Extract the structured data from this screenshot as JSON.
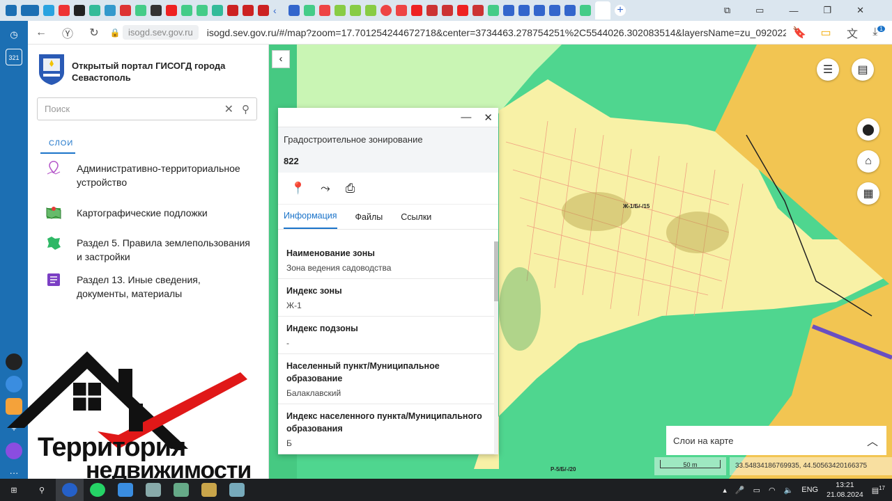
{
  "browser": {
    "site_chip": "isogd.sev.gov.ru",
    "url": "isogd.sev.gov.ru/#/map?zoom=17.701254244672718&center=3734463.278754251%2C5544026.302083514&layersName=zu_092022_...",
    "sidebar_badge": "321",
    "download_badge": "1"
  },
  "left_panel": {
    "portal_title": "Открытый портал ГИСОГД города Севастополь",
    "search_placeholder": "Поиск",
    "layers_tab": "СЛОИ",
    "layers": [
      {
        "label": "Административно-территориальное устройство",
        "icon": "map-pin-purple-icon"
      },
      {
        "label": "Картографические подложки",
        "icon": "map-basemap-icon"
      },
      {
        "label": "Раздел 5. Правила землепользования и застройки",
        "icon": "region-map-icon"
      },
      {
        "label": "Раздел 13. Иные сведения, документы, материалы",
        "icon": "document-list-icon"
      }
    ]
  },
  "popup": {
    "title": "Градостроительное зонирование",
    "number": "822",
    "tabs": [
      "Информация",
      "Файлы",
      "Ссылки"
    ],
    "fields": [
      {
        "label": "Наименование зоны",
        "value": "Зона ведения садоводства"
      },
      {
        "label": "Индекс зоны",
        "value": "Ж-1"
      },
      {
        "label": "Индекс подзоны",
        "value": "-"
      },
      {
        "label": "Населенный пункт/Муниципальное образование",
        "value": "Балаклавский"
      },
      {
        "label": "Индекс населенного пункта/Муниципального образования",
        "value": "Б"
      }
    ]
  },
  "map": {
    "labels": [
      "Ж-1/Б/-/15",
      "Р-5/Б/-/20"
    ],
    "layers_panel_title": "Слои на карте",
    "scale": "50 m",
    "coordinates": "33.54834186769935, 44.50563420166375",
    "colors": {
      "green": "#4fd68f",
      "light_green": "#c9f5b4",
      "yellow": "#f8f1a6",
      "orange": "#f2c552"
    }
  },
  "watermark": {
    "line1": "Территория",
    "line2": "недвижимости"
  },
  "taskbar": {
    "language": "ENG",
    "time": "13:21",
    "date": "21.08.2024",
    "notifications": "17"
  }
}
